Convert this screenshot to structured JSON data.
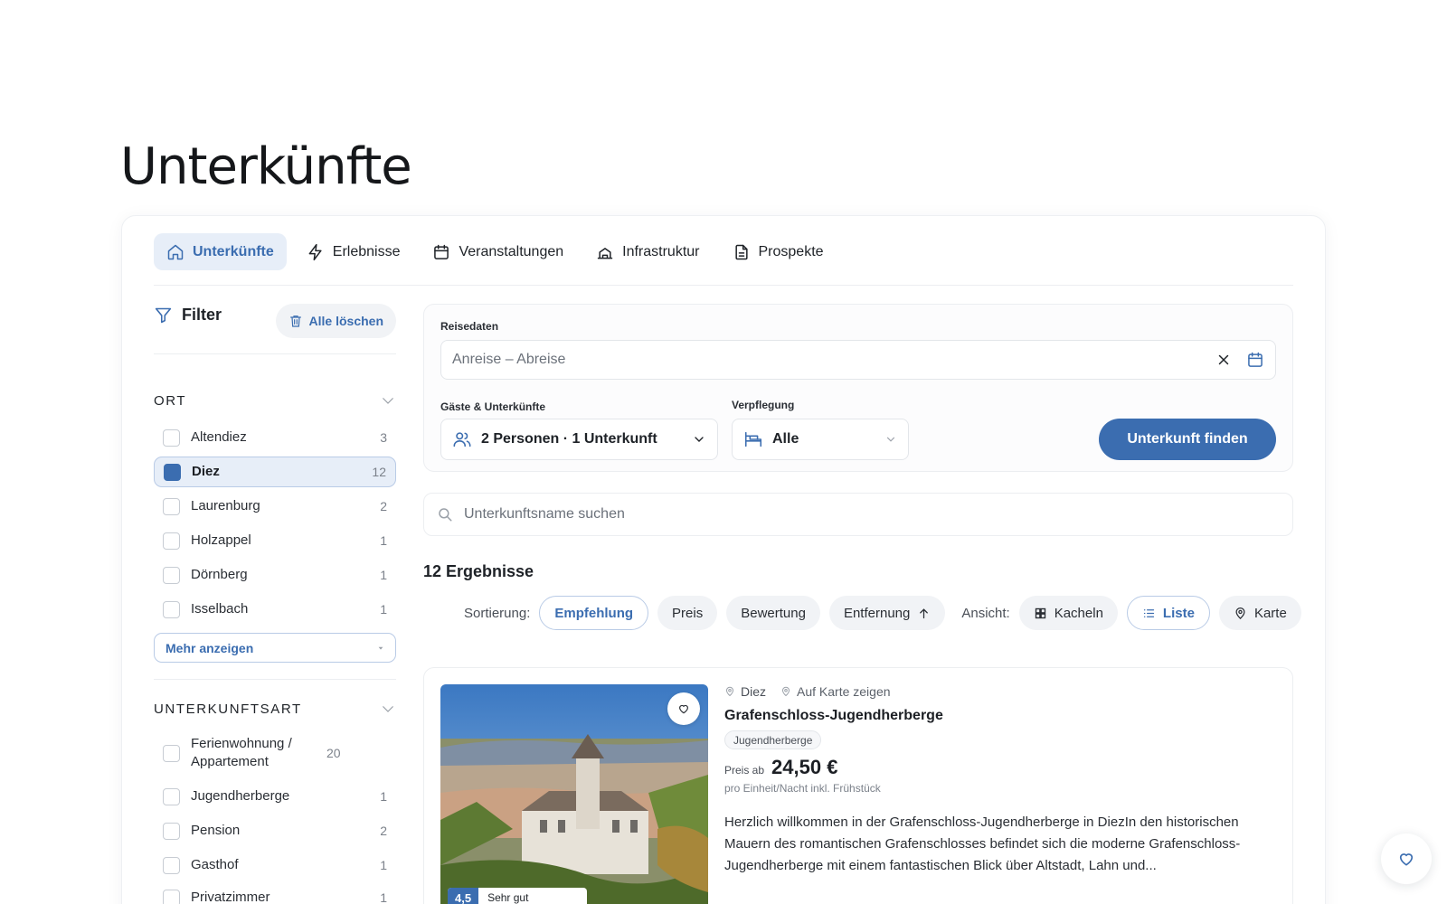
{
  "page": {
    "title": "Unterkünfte"
  },
  "tabs": [
    {
      "label": "Unterkünfte",
      "icon": "home-icon",
      "active": true
    },
    {
      "label": "Erlebnisse",
      "icon": "bolt-icon"
    },
    {
      "label": "Veranstaltungen",
      "icon": "calendar-icon"
    },
    {
      "label": "Infrastruktur",
      "icon": "building-icon"
    },
    {
      "label": "Prospekte",
      "icon": "document-icon"
    }
  ],
  "filter": {
    "title": "Filter",
    "clear_label": "Alle löschen",
    "ort": {
      "title": "ORT",
      "options": [
        {
          "label": "Altendiez",
          "count": "3",
          "checked": false
        },
        {
          "label": "Diez",
          "count": "12",
          "checked": true
        },
        {
          "label": "Laurenburg",
          "count": "2",
          "checked": false
        },
        {
          "label": "Holzappel",
          "count": "1",
          "checked": false
        },
        {
          "label": "Dörnberg",
          "count": "1",
          "checked": false
        },
        {
          "label": "Isselbach",
          "count": "1",
          "checked": false
        }
      ],
      "more_label": "Mehr anzeigen"
    },
    "unterkunftsart": {
      "title": "UNTERKUNFTSART",
      "options": [
        {
          "label": "Ferienwohnung / Appartement",
          "count": "20",
          "checked": false
        },
        {
          "label": "Jugendherberge",
          "count": "1",
          "checked": false
        },
        {
          "label": "Pension",
          "count": "2",
          "checked": false
        },
        {
          "label": "Gasthof",
          "count": "1",
          "checked": false
        },
        {
          "label": "Privatzimmer",
          "count": "1",
          "checked": false
        }
      ]
    }
  },
  "search": {
    "dates_label": "Reisedaten",
    "dates_placeholder": "Anreise – Abreise",
    "guests_label": "Gäste & Unterkünfte",
    "guests_value": "2 Personen · 1 Unterkunft",
    "board_label": "Verpflegung",
    "board_value": "Alle",
    "find_label": "Unterkunft finden",
    "name_placeholder": "Unterkunftsname suchen"
  },
  "results": {
    "count_label": "12 Ergebnisse",
    "sort_label": "Sortierung:",
    "sort_options": [
      {
        "label": "Empfehlung",
        "active": true
      },
      {
        "label": "Preis",
        "active": false
      },
      {
        "label": "Bewertung",
        "active": false
      },
      {
        "label": "Entfernung",
        "active": false
      }
    ],
    "view_label": "Ansicht:",
    "view_options": [
      {
        "label": "Kacheln",
        "active": false
      },
      {
        "label": "Liste",
        "active": true
      },
      {
        "label": "Karte",
        "active": false
      }
    ],
    "items": [
      {
        "city": "Diez",
        "map_link": "Auf Karte zeigen",
        "name": "Grafenschloss-Jugendherberge",
        "type": "Jugendherberge",
        "price_from": "Preis ab",
        "price": "24,50 €",
        "price_note": "pro Einheit/Nacht inkl. Frühstück",
        "description": "Herzlich willkommen in der Grafenschloss-Jugendherberge in DiezIn den historischen Mauern des romantischen Grafenschlosses befindet sich die moderne Grafenschloss-Jugendherberge mit einem fantastischen Blick über Altstadt, Lahn und...",
        "rating_score": "4,5",
        "rating_word": "Sehr gut"
      }
    ]
  },
  "colors": {
    "accent": "#3b6db0",
    "accent_light": "#e7eef8",
    "border": "#eceef1"
  }
}
